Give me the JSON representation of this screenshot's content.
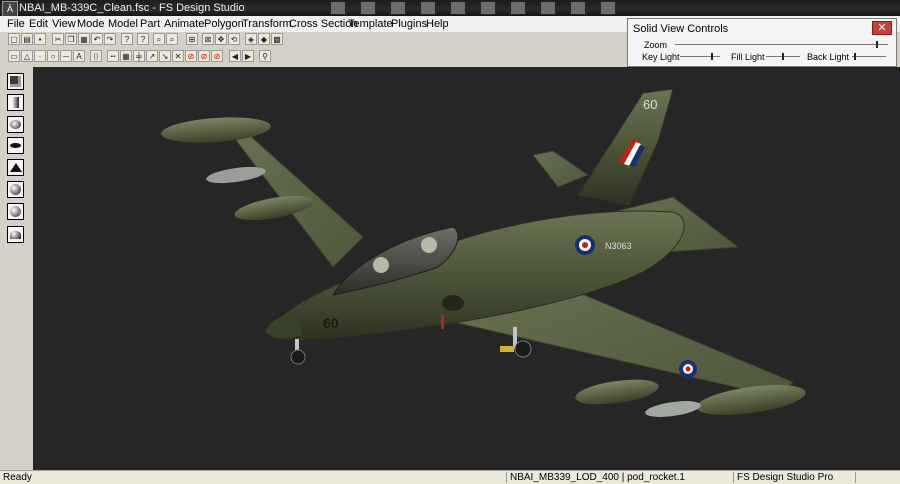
{
  "window": {
    "title": "NBAI_MB-339C_Clean.fsc - FS Design Studio",
    "icon": "fsds-app-icon"
  },
  "menu": {
    "items": [
      "File",
      "Edit",
      "View",
      "Mode",
      "Model",
      "Part",
      "Animate",
      "Polygon",
      "Transform",
      "Cross Section",
      "Template",
      "Plugins",
      "Help"
    ]
  },
  "solid_view_controls": {
    "title": "Solid View Controls",
    "close_label": "✕",
    "zoom_label": "Zoom",
    "key_light_label": "Key Light",
    "fill_light_label": "Fill Light",
    "back_light_label": "Back Light",
    "zoom_value": 0.95,
    "key_light_value": 0.8,
    "fill_light_value": 0.5,
    "back_light_value": 0.1
  },
  "aircraft": {
    "nose_number": "60",
    "tail_number": "60",
    "serial": "N3063",
    "colors": {
      "fuselage": "#4d5539",
      "wing": "#5d6648",
      "roundel_blue": "#1a2f6e",
      "roundel_red": "#c0201c"
    }
  },
  "status": {
    "ready": "Ready",
    "selection": "NBAI_MB339_LOD_400 | pod_rocket.1",
    "product": "FS Design Studio Pro"
  },
  "icons": {
    "toolbar1": [
      "new-file-icon",
      "open-file-icon",
      "save-file-icon",
      "cut-icon",
      "copy-icon",
      "paste-icon",
      "undo-icon",
      "redo-icon",
      "help-icon",
      "zoom-in-icon",
      "zoom-out-icon",
      "zoom-extents-icon",
      "zoom-window-icon",
      "zoom-selection-icon",
      "pan-icon",
      "rotate-view-icon",
      "wireframe-view-icon",
      "solid-view-icon",
      "texture-view-icon"
    ],
    "toolbar2": [
      "select-point-icon",
      "select-polygon-icon",
      "select-part-icon",
      "select-circle-icon",
      "select-line-icon",
      "select-text-icon",
      "insert-icon",
      "ruler-icon",
      "grid-icon",
      "grid-lines-icon",
      "rotate-cw-icon",
      "scale-icon",
      "mirror-icon",
      "stop-red-icon",
      "stop-red-2-icon",
      "stop-red-3-icon",
      "prev-part-icon",
      "next-part-icon",
      "binoculars-icon"
    ],
    "palette": [
      "cube-icon",
      "cylinder-icon",
      "ellipsoid-icon",
      "disc-icon",
      "cone-icon",
      "sphere-icon",
      "geosphere-icon",
      "hemisphere-icon"
    ]
  }
}
